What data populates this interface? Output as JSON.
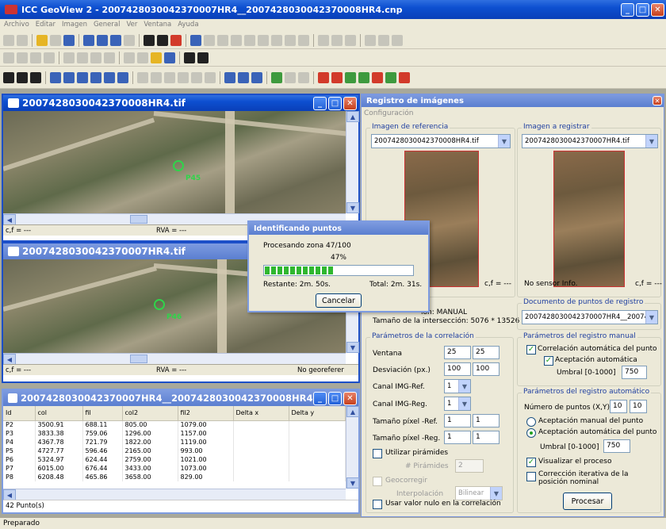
{
  "app": {
    "title": "ICC GeoView 2 - 2007428030042370007HR4__2007428030042370008HR4.cnp",
    "menu": [
      "Archivo",
      "Editar",
      "Imagen",
      "General",
      "Ver",
      "Ventana",
      "Ayuda"
    ]
  },
  "win1": {
    "title": "2007428030042370008HR4.tif",
    "status_left": "c,f = ---",
    "status_mid": "RVA = ---",
    "marker": "P45"
  },
  "win2": {
    "title": "2007428030042370007HR4.tif",
    "status_left": "c,f = ---",
    "status_mid": "RVA = ---",
    "status_right": "No georeferer",
    "marker": "P46"
  },
  "win3": {
    "title": "2007428030042370007HR4__2007428030042370008HR4.cnp (...",
    "columns": [
      "Id",
      "col",
      "fil",
      "col2",
      "fil2",
      "Delta x",
      "Delta y"
    ],
    "rows": [
      [
        "P2",
        "3500.91",
        "688.11",
        "805.00",
        "1079.00",
        "",
        ""
      ],
      [
        "P3",
        "3833.38",
        "759.06",
        "1296.00",
        "1157.00",
        "",
        ""
      ],
      [
        "P4",
        "4367.78",
        "721.79",
        "1822.00",
        "1119.00",
        "",
        ""
      ],
      [
        "P5",
        "4727.77",
        "596.46",
        "2165.00",
        "993.00",
        "",
        ""
      ],
      [
        "P6",
        "5324.97",
        "624.44",
        "2759.00",
        "1021.00",
        "",
        ""
      ],
      [
        "P7",
        "6015.00",
        "676.44",
        "3433.00",
        "1073.00",
        "",
        ""
      ],
      [
        "P8",
        "6208.48",
        "465.86",
        "3658.00",
        "829.00",
        "",
        ""
      ]
    ],
    "footer": "42 Punto(s)"
  },
  "status_bar": "Preparado",
  "progress": {
    "title": "Identificando puntos",
    "zone_text": "Procesando zona 47/100",
    "percent_text": "47%",
    "fraction": 0.47,
    "remaining": "Restante: 2m. 50s.",
    "total": "Total: 2m. 31s.",
    "cancel": "Cancelar"
  },
  "reg": {
    "title": "Registro de imágenes",
    "config": "Configuración",
    "ref_group": "Imagen de referencia",
    "ref_select": "2007428030042370008HR4.tif",
    "reg_group": "Imagen a registrar",
    "reg_select": "2007428030042370007HR4.tif",
    "cf_left": "c,f = ---",
    "no_sensor": "No sensor Info.",
    "cf_right": "c,f = ---",
    "mode_text": "ión: MANUAL",
    "intersect": "Tamaño de la intersección: 5076 * 13526",
    "doc_group": "Documento de puntos de registro",
    "doc_select": "2007428030042370007HR4__20074",
    "corr_group": "Parámetros de la correlación",
    "ventana_label": "Ventana",
    "ventana_a": "25",
    "ventana_b": "25",
    "desv_label": "Desviación (px.)",
    "desv_a": "100",
    "desv_b": "100",
    "canal_ref_label": "Canal IMG-Ref.",
    "canal_ref_val": "1",
    "canal_reg_label": "Canal IMG-Reg.",
    "canal_reg_val": "1",
    "tam_ref_label": "Tamaño píxel -Ref.",
    "tam_ref_a": "1",
    "tam_ref_b": "1",
    "tam_reg_label": "Tamaño píxel -Reg.",
    "tam_reg_a": "1",
    "tam_reg_b": "1",
    "piramides_label": "Utilizar pirámides",
    "n_piramides_label": "# Pirámides",
    "n_piramides_val": "2",
    "geocorr_label": "Geocorregir",
    "interp_label": "Interpolación",
    "interp_val": "Bilinear",
    "nulo_label": "Usar valor nulo en la correlación",
    "manual_group": "Parámetros del registro manual",
    "corr_auto_label": "Correlación  automática del punto",
    "acept_auto_label": "Aceptación automática",
    "umbral_label": "Umbral [0-1000]",
    "umbral_val": "750",
    "auto_group": "Parámetros del registro automático",
    "npuntos_label": "Número de puntos (X,Y):",
    "npuntos_x": "10",
    "npuntos_y": "10",
    "acept_manual_label": "Aceptación manual del punto",
    "acept_auto2_label": "Aceptación automática del punto",
    "umbral2_label": "Umbral [0-1000]",
    "umbral2_val": "750",
    "visualizar_label": "Visualizar el proceso",
    "iterativa_label": "Corrección iterativa de la posición nominal",
    "procesar": "Procesar"
  }
}
